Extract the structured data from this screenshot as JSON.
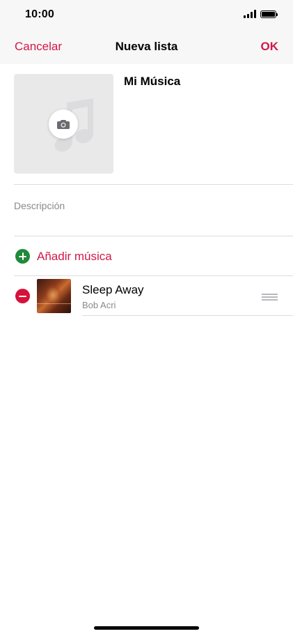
{
  "status_bar": {
    "time": "10:00"
  },
  "nav": {
    "cancel_label": "Cancelar",
    "title": "Nueva lista",
    "ok_label": "OK"
  },
  "playlist": {
    "name": "Mi Música",
    "description_placeholder": "Descripción",
    "artwork_icon": "music-note-icon",
    "camera_icon": "camera-icon"
  },
  "actions": {
    "add_music_label": "Añadir música",
    "add_icon": "plus-circle-icon"
  },
  "tracks": [
    {
      "title": "Sleep Away",
      "artist": "Bob Acri",
      "remove_icon": "minus-circle-icon",
      "handle_icon": "drag-handle-icon"
    }
  ],
  "colors": {
    "accent": "#d11849",
    "add_green": "#1f8a3a",
    "remove_red": "#d6123a",
    "secondary_text": "#8a8a8e"
  }
}
